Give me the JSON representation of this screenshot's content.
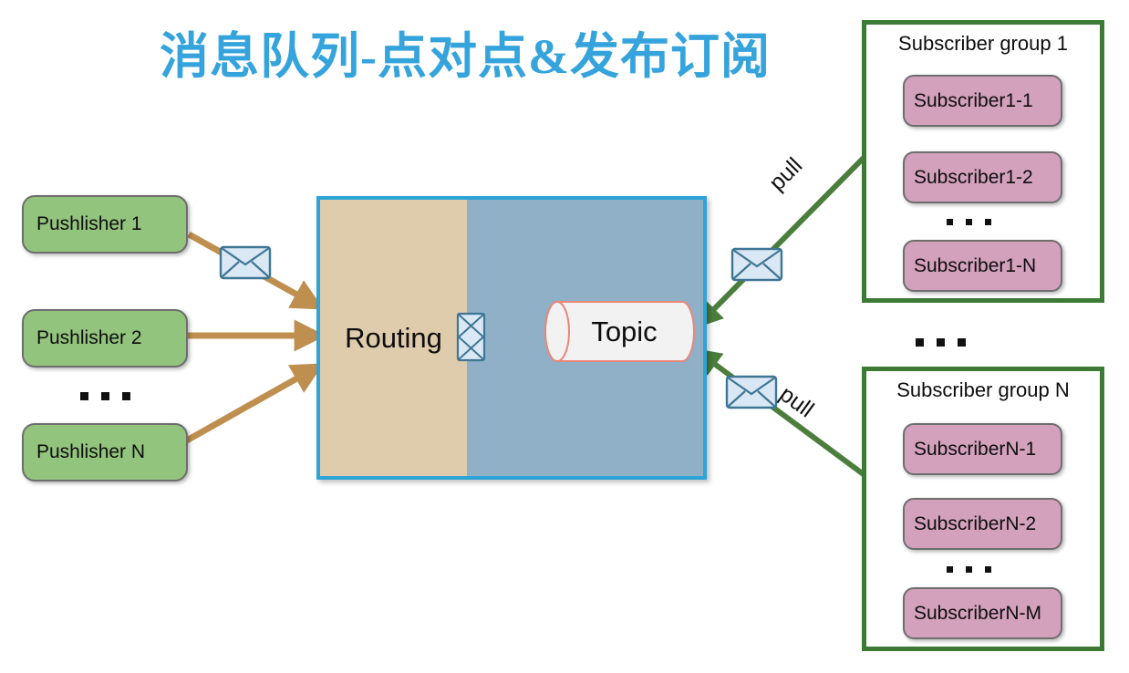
{
  "title": "消息队列-点对点&发布订阅",
  "colors": {
    "title": "#35A3DC",
    "publisher_fill": "#93C47D",
    "subscriber_fill": "#D3A1BC",
    "broker_border": "#2EA3D6",
    "routing_fill": "#DFCCAD",
    "broker_fill": "#8FB0C6",
    "group_border": "#3C7A36",
    "push_arrow": "#BF8F4F",
    "pull_arrow": "#4B7D3C",
    "inner_arrow": "#E8751A",
    "topic_outline": "#E8877A"
  },
  "publishers": {
    "items": [
      {
        "label": "Pushlisher 1"
      },
      {
        "label": "Pushlisher 2"
      },
      {
        "label": "Pushlisher N"
      }
    ],
    "ellipsis": "..."
  },
  "broker": {
    "routing_label": "Routing",
    "topic_label": "Topic",
    "envelope_icon": "envelope-icon"
  },
  "edges": {
    "pull_label_top": "pull",
    "pull_label_bottom": "pull",
    "push_envelope_icon": "envelope-icon",
    "pull_envelope_icon_top": "envelope-icon",
    "pull_envelope_icon_bottom": "envelope-icon"
  },
  "groups": [
    {
      "title": "Subscriber group 1",
      "members": [
        {
          "label": "Subscriber1-1"
        },
        {
          "label": "Subscriber1-2"
        },
        {
          "label": "Subscriber1-N"
        }
      ],
      "ellipsis": "..."
    },
    {
      "title": "Subscriber group N",
      "members": [
        {
          "label": "SubscriberN-1"
        },
        {
          "label": "SubscriberN-2"
        },
        {
          "label": "SubscriberN-M"
        }
      ],
      "ellipsis": "..."
    }
  ],
  "group_ellipsis": "..."
}
